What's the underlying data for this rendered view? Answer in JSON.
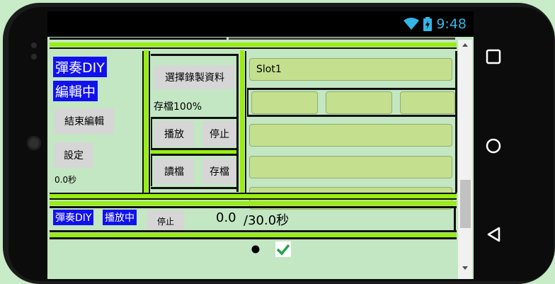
{
  "status": {
    "time": "9:48",
    "wifi_icon": "wifi-icon",
    "battery_icon": "battery-icon"
  },
  "left_panel": {
    "title_label": "彈奏DIY",
    "mode_label": "編輯中",
    "end_edit_button": "結束編輯",
    "settings_button": "設定",
    "time_readout": "0.0秒"
  },
  "middle_panel": {
    "select_record_button": "選擇錄製資料",
    "save_progress": "存檔100%",
    "play_button": "播放",
    "stop_button": "停止",
    "load_button": "讀檔",
    "save_button": "存檔"
  },
  "right_panel": {
    "slot_field_value": "Slot1",
    "field_row_values": [
      "",
      "",
      ""
    ],
    "fields": [
      "",
      "",
      ""
    ]
  },
  "bottom_bar": {
    "title_label": "彈奏DIY",
    "playing_label": "播放中",
    "stop_button": "停止",
    "current_time": "0.0",
    "total_time": "/30.0秒"
  },
  "footer": {
    "dot_icon": "dot-icon",
    "check_icon": "checkmark-icon"
  },
  "colors": {
    "accent_green": "#99ee11",
    "label_blue": "#1111ee",
    "field_green": "#c4df8e",
    "screen_bg": "#c3e6c3"
  }
}
